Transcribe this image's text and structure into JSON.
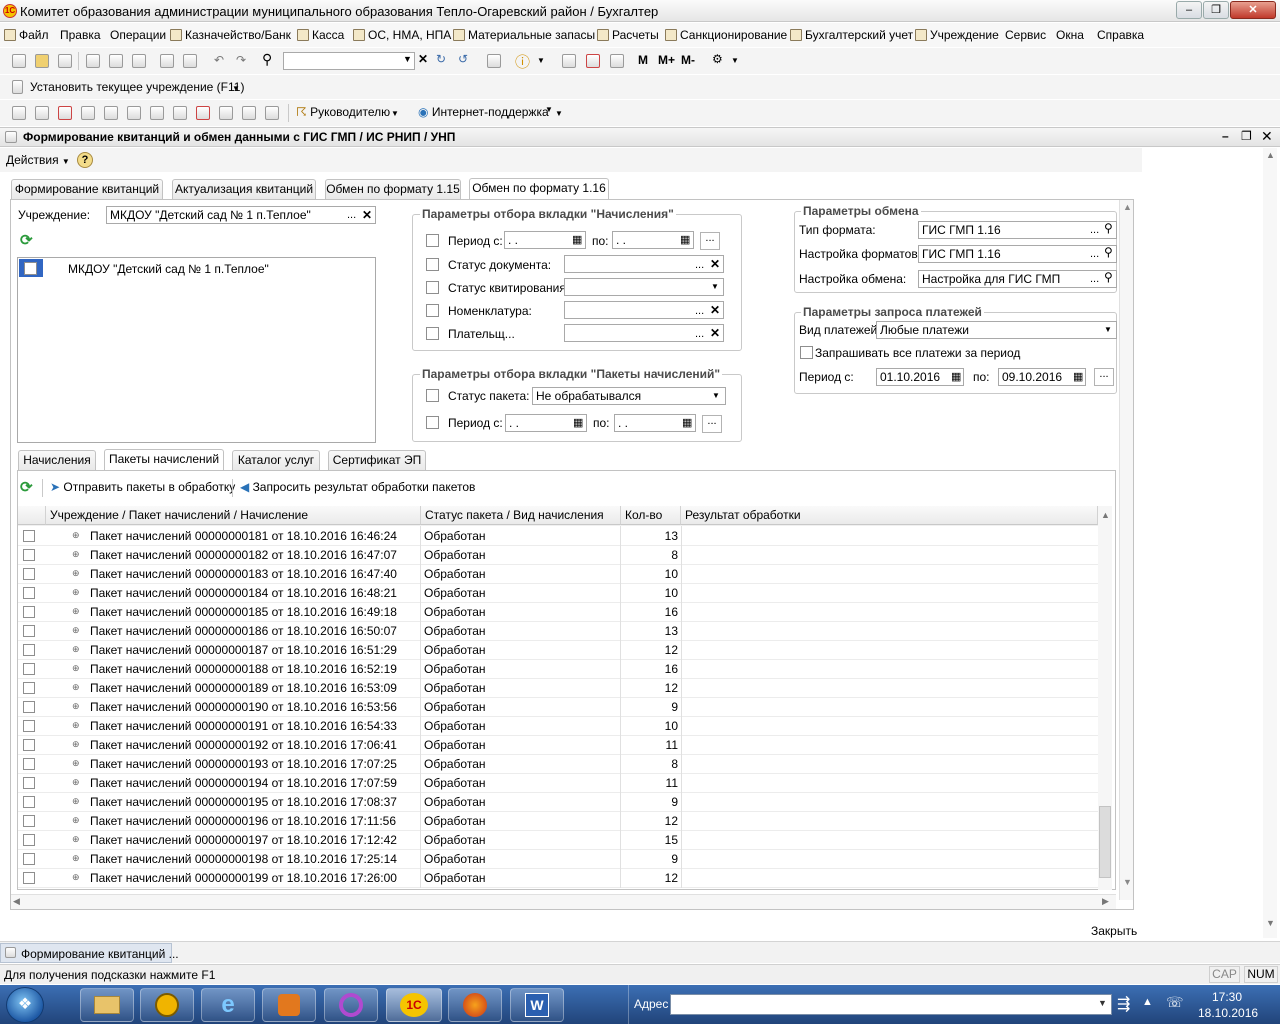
{
  "window": {
    "title": "Комитет образования администрации муниципального образования Тепло-Огаревский район / Бухгалтер"
  },
  "menu": [
    "Файл",
    "Правка",
    "Операции",
    "Казначейство/Банк",
    "Касса",
    "ОС, НМА, НПА",
    "Материальные запасы",
    "Расчеты",
    "Санкционирование",
    "Бухгалтерский учет",
    "Учреждение",
    "Сервис",
    "Окна",
    "Справка"
  ],
  "toolbar": {
    "m": "M",
    "m_plus": "M+",
    "m_minus": "M-",
    "set_institution": "Установить текущее учреждение (F11)",
    "manager": "Руководителю",
    "support": "Интернет-поддержка"
  },
  "doc": {
    "title": "Формирование квитанций и обмен данными с ГИС ГМП / ИС РНИП / УНП",
    "actions": "Действия",
    "help": "?",
    "tabs": [
      "Формирование квитанций",
      "Актуализация квитанций",
      "Обмен по формату 1.15",
      "Обмен по формату 1.16"
    ],
    "institution_label": "Учреждение:",
    "institution_value": "МКДОУ \"Детский сад № 1 п.Теплое\"",
    "institution_list_item": "МКДОУ \"Детский сад № 1 п.Теплое\"",
    "filter1": {
      "title": "Параметры отбора вкладки \"Начисления\"",
      "period_from": "Период с:",
      "period_to": "по:",
      "date_empty": " .  .",
      "doc_status": "Статус документа:",
      "kvit_status": "Статус квитирования:",
      "nomenclature": "Номенклатура:",
      "payer": "Плательщ..."
    },
    "filter2": {
      "title": "Параметры отбора вкладки \"Пакеты начислений\"",
      "package_status": "Статус пакета:",
      "package_status_value": "Не обрабатывался",
      "period_from": "Период с:",
      "period_to": "по:",
      "date_empty": " .  ."
    },
    "exchange": {
      "title": "Параметры обмена",
      "format_type": "Тип формата:",
      "format_type_value": "ГИС ГМП 1.16",
      "format_settings": "Настройка форматов:",
      "format_settings_value": "ГИС ГМП 1.16",
      "exchange_settings": "Настройка обмена:",
      "exchange_settings_value": "Настройка для ГИС ГМП"
    },
    "payments": {
      "title": "Параметры запроса платежей",
      "kind_label": "Вид платежей:",
      "kind_value": "Любые платежи",
      "all_period": "Запрашивать все платежи за период",
      "period_from": "Период с:",
      "date_from": "01.10.2016",
      "period_to": "по:",
      "date_to": "09.10.2016"
    },
    "lower_tabs": [
      "Начисления",
      "Пакеты начислений",
      "Каталог услуг",
      "Сертификат ЭП"
    ],
    "send_packages": "Отправить пакеты в обработку",
    "request_results": "Запросить результат обработки пакетов",
    "columns": [
      "Учреждение / Пакет начислений / Начисление",
      "Статус пакета / Вид начисления",
      "Кол-во",
      "Результат обработки"
    ],
    "rows": [
      {
        "name": "Пакет начислений 00000000181 от 18.10.2016 16:46:24",
        "status": "Обработан",
        "qty": "13"
      },
      {
        "name": "Пакет начислений 00000000182 от 18.10.2016 16:47:07",
        "status": "Обработан",
        "qty": "8"
      },
      {
        "name": "Пакет начислений 00000000183 от 18.10.2016 16:47:40",
        "status": "Обработан",
        "qty": "10"
      },
      {
        "name": "Пакет начислений 00000000184 от 18.10.2016 16:48:21",
        "status": "Обработан",
        "qty": "10"
      },
      {
        "name": "Пакет начислений 00000000185 от 18.10.2016 16:49:18",
        "status": "Обработан",
        "qty": "16"
      },
      {
        "name": "Пакет начислений 00000000186 от 18.10.2016 16:50:07",
        "status": "Обработан",
        "qty": "13"
      },
      {
        "name": "Пакет начислений 00000000187 от 18.10.2016 16:51:29",
        "status": "Обработан",
        "qty": "12"
      },
      {
        "name": "Пакет начислений 00000000188 от 18.10.2016 16:52:19",
        "status": "Обработан",
        "qty": "16"
      },
      {
        "name": "Пакет начислений 00000000189 от 18.10.2016 16:53:09",
        "status": "Обработан",
        "qty": "12"
      },
      {
        "name": "Пакет начислений 00000000190 от 18.10.2016 16:53:56",
        "status": "Обработан",
        "qty": "9"
      },
      {
        "name": "Пакет начислений 00000000191 от 18.10.2016 16:54:33",
        "status": "Обработан",
        "qty": "10"
      },
      {
        "name": "Пакет начислений 00000000192 от 18.10.2016 17:06:41",
        "status": "Обработан",
        "qty": "11"
      },
      {
        "name": "Пакет начислений 00000000193 от 18.10.2016 17:07:25",
        "status": "Обработан",
        "qty": "8"
      },
      {
        "name": "Пакет начислений 00000000194 от 18.10.2016 17:07:59",
        "status": "Обработан",
        "qty": "11"
      },
      {
        "name": "Пакет начислений 00000000195 от 18.10.2016 17:08:37",
        "status": "Обработан",
        "qty": "9"
      },
      {
        "name": "Пакет начислений 00000000196 от 18.10.2016 17:11:56",
        "status": "Обработан",
        "qty": "12"
      },
      {
        "name": "Пакет начислений 00000000197 от 18.10.2016 17:12:42",
        "status": "Обработан",
        "qty": "15"
      },
      {
        "name": "Пакет начислений 00000000198 от 18.10.2016 17:25:14",
        "status": "Обработан",
        "qty": "9"
      },
      {
        "name": "Пакет начислений 00000000199 от 18.10.2016 17:26:00",
        "status": "Обработан",
        "qty": "12"
      }
    ],
    "close": "Закрыть"
  },
  "window_tab": "Формирование квитанций ...",
  "statusbar": {
    "hint": "Для получения подсказки нажмите F1",
    "cap": "CAP",
    "num": "NUM"
  },
  "taskbar": {
    "address_label": "Адрес",
    "time": "17:30",
    "date": "18.10.2016"
  },
  "colors": {
    "group_title": "#4b4b4b",
    "taskbar": "#2a5596",
    "refresh_icon": "#2b9a3b"
  }
}
